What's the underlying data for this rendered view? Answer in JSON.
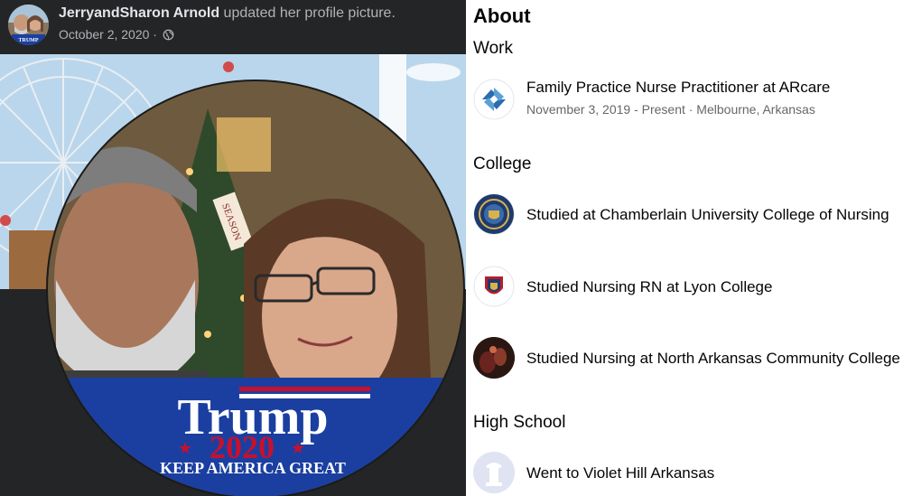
{
  "post": {
    "author_name": "JerryandSharon Arnold",
    "action": " updated her profile picture.",
    "date": "October 2, 2020",
    "separator": " · ",
    "privacy_icon": "globe-icon",
    "banner_line1": "Trump",
    "banner_line2": "2020",
    "banner_line3": "KEEP AMERICA GREAT",
    "sign_text": "SEASON",
    "avatar_badge": "TRUMP"
  },
  "about": {
    "title": "About",
    "work_title": "Work",
    "work": {
      "title": "Family Practice Nurse Practitioner at ARcare",
      "subtitle": "November 3, 2019 - Present · Melbourne, Arkansas",
      "icon": "arcare-logo-icon"
    },
    "college_title": "College",
    "college": [
      {
        "label": "Studied at Chamberlain University College of Nursing",
        "icon": "chamberlain-seal-icon"
      },
      {
        "label": "Studied Nursing RN at Lyon College",
        "icon": "lyon-crest-icon"
      },
      {
        "label": "Studied Nursing at North Arkansas Community College",
        "icon": "school-photo-icon"
      }
    ],
    "highschool_title": "High School",
    "highschool": {
      "label": "Went to Violet Hill Arkansas",
      "icon": "school-placeholder-icon"
    }
  },
  "colors": {
    "post_bg": "#242526",
    "banner_blue": "#1b3fa0",
    "banner_red": "#c8102e",
    "sky": "#b9d6ec",
    "arcare_blue": "#2b6cb0"
  }
}
